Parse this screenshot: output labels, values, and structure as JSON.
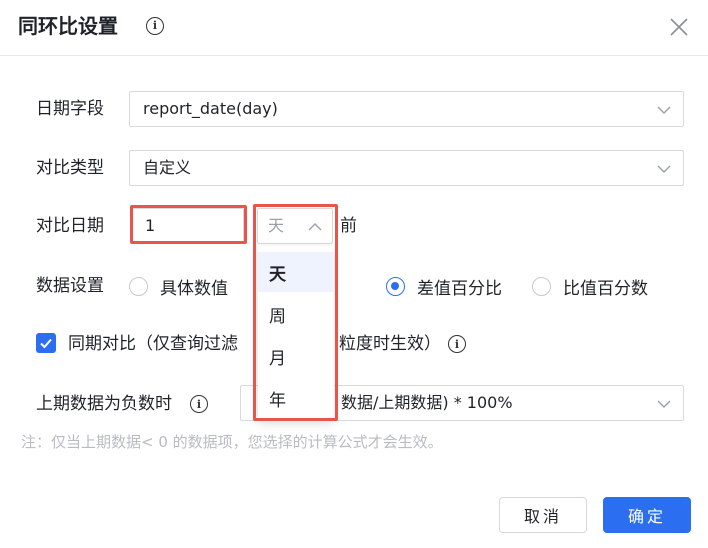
{
  "dialog": {
    "title": "同环比设置",
    "info_glyph": "i"
  },
  "date_field": {
    "label": "日期字段",
    "value": "report_date(day)"
  },
  "compare_type": {
    "label": "对比类型",
    "value": "自定义"
  },
  "compare_date": {
    "label": "对比日期",
    "number": "1",
    "unit": "天",
    "suffix": "前"
  },
  "unit_options": [
    "天",
    "周",
    "月",
    "年"
  ],
  "data_setting": {
    "label": "数据设置",
    "options": [
      "具体数值",
      "差值",
      "差值百分比",
      "比值百分数"
    ],
    "option_visible_text": [
      "具体数值",
      "差值",
      "差值百分比",
      "比值百分数"
    ],
    "selected": "差值百分比"
  },
  "same_period": {
    "checked": true,
    "label_left": "同期对比（仅查询过滤",
    "label_right": "粒度时生效）"
  },
  "negative_prev": {
    "label": "上期数据为负数时",
    "value_visible": "数据/上期数据) * 100%"
  },
  "note": "注：仅当上期数据< 0 的数据项，您选择的计算公式才会生效。",
  "buttons": {
    "cancel": "取消",
    "ok": "确定"
  },
  "colors": {
    "primary": "#2b6ff0",
    "highlight_red": "#e8554a",
    "muted": "#b8bcc2"
  }
}
